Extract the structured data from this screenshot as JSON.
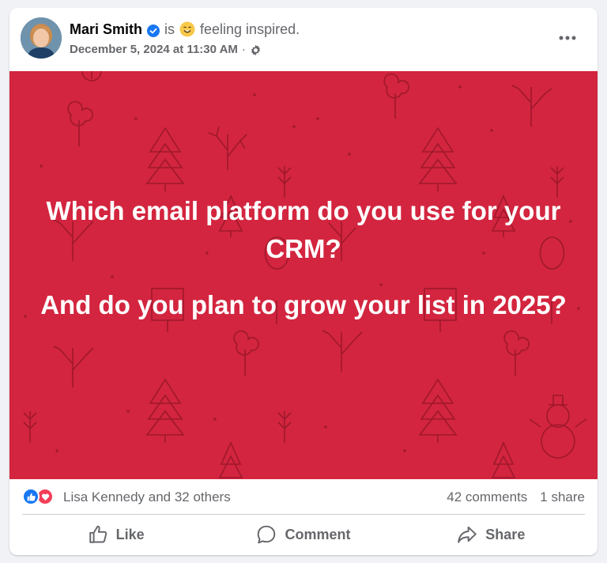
{
  "post": {
    "author": "Mari Smith",
    "verified": true,
    "activity_prefix": "is",
    "activity_emoji": "smiling-face-emoji",
    "activity": "feeling inspired.",
    "timestamp": "December 5, 2024 at 11:30 AM",
    "timestamp_separator": "·",
    "audience_icon": "gear-icon",
    "more_icon": "more-options-icon"
  },
  "image": {
    "background_color": "#d3253f",
    "line1": "Which email platform do you use for your CRM?",
    "line2": "And do you plan to grow your list in 2025?"
  },
  "reactions": {
    "icons": [
      "like-reaction-icon",
      "love-reaction-icon"
    ],
    "summary": "Lisa Kennedy and 32 others",
    "comments": "42 comments",
    "shares": "1 share"
  },
  "actions": {
    "like": "Like",
    "comment": "Comment",
    "share": "Share"
  },
  "colors": {
    "accent": "#1877f2",
    "love": "#f33e58",
    "secondary_text": "#65676b"
  }
}
